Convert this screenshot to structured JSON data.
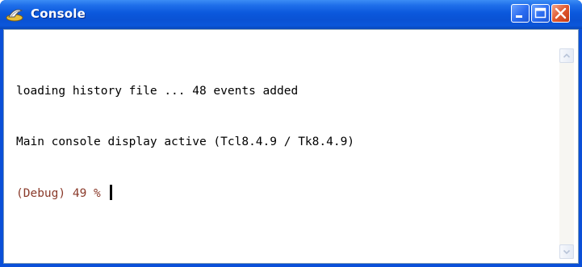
{
  "window": {
    "title": "Console",
    "app_icon": "tcl-feather-icon",
    "controls": {
      "minimize": "minimize-icon",
      "maximize": "maximize-icon",
      "close": "close-icon"
    }
  },
  "console": {
    "lines": [
      "loading history file ... 48 events added",
      "Main console display active (Tcl8.4.9 / Tk8.4.9)"
    ],
    "prompt": "(Debug) 49 %"
  },
  "colors": {
    "titlebar": "#0a52d4",
    "prompt": "#8a3a2a",
    "text": "#000000"
  }
}
